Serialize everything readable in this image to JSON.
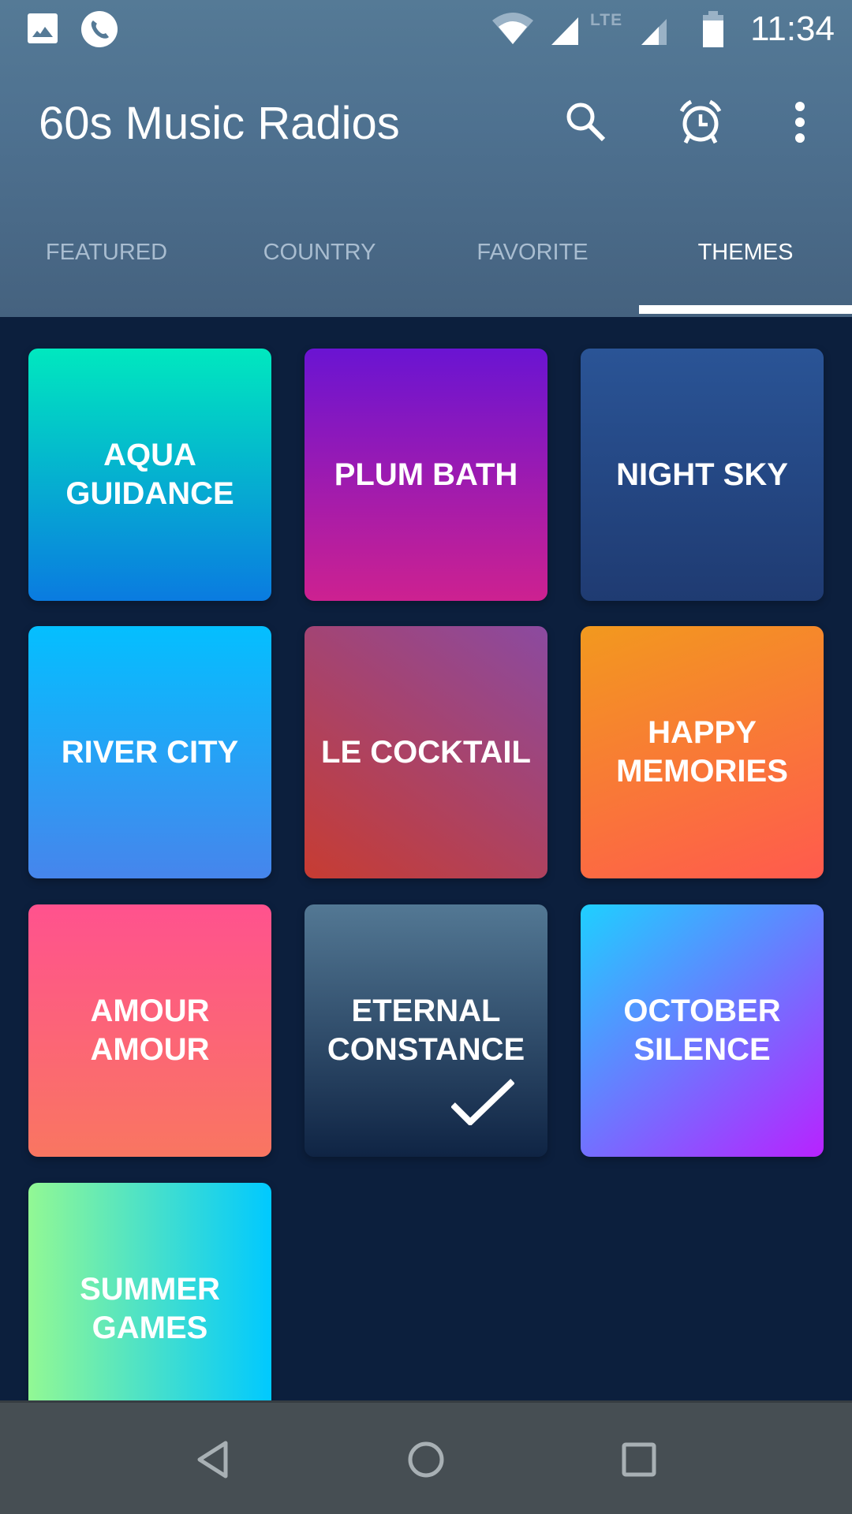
{
  "status_bar": {
    "left_icons": [
      "image-icon",
      "phone-call-icon"
    ],
    "right_icons": [
      "wifi-icon",
      "signal-icon",
      "lte-signal-icon",
      "battery-icon"
    ],
    "network_label": "LTE",
    "time": "11:34"
  },
  "app_bar": {
    "title": "60s Music Radios",
    "actions": [
      {
        "name": "search",
        "icon": "search-icon"
      },
      {
        "name": "alarm",
        "icon": "alarm-clock-icon"
      },
      {
        "name": "more",
        "icon": "more-vert-icon"
      }
    ]
  },
  "tabs": [
    {
      "label": "FEATURED",
      "active": false
    },
    {
      "label": "COUNTRY",
      "active": false
    },
    {
      "label": "FAVORITE",
      "active": false
    },
    {
      "label": "THEMES",
      "active": true
    }
  ],
  "themes": [
    {
      "label": "AQUA\nGUIDANCE",
      "colors": [
        "#00e8bf",
        "#0a7be0"
      ],
      "selected": false
    },
    {
      "label": "PLUM BATH",
      "colors": [
        "#6a14d2",
        "#cd2190"
      ],
      "selected": false
    },
    {
      "label": "NIGHT SKY",
      "colors": [
        "#2a5496",
        "#1f3b72"
      ],
      "selected": false
    },
    {
      "label": "RIVER CITY",
      "colors": [
        "#04bfff",
        "#4685ec"
      ],
      "selected": false
    },
    {
      "label": "LE COCKTAIL",
      "colors": [
        "#c73c32",
        "#8b4aa0"
      ],
      "selected": false
    },
    {
      "label": "HAPPY\nMEMORIES",
      "colors": [
        "#f2991e",
        "#ff5a4e"
      ],
      "selected": false
    },
    {
      "label": "AMOUR\nAMOUR",
      "colors": [
        "#ff528e",
        "#f97661"
      ],
      "selected": false
    },
    {
      "label": "ETERNAL\nCONSTANCE",
      "colors": [
        "#537894",
        "#0f2444"
      ],
      "selected": true
    },
    {
      "label": "OCTOBER\nSILENCE",
      "colors": [
        "#1ed0ff",
        "#b822ff"
      ],
      "selected": false
    },
    {
      "label": "SUMMER\nGAMES",
      "colors": [
        "#92f894",
        "#00c9ff"
      ],
      "selected": false
    }
  ],
  "nav_bar": {
    "buttons": [
      {
        "name": "back",
        "icon": "back-triangle-icon"
      },
      {
        "name": "home",
        "icon": "home-circle-icon"
      },
      {
        "name": "recents",
        "icon": "recents-square-icon"
      }
    ]
  }
}
